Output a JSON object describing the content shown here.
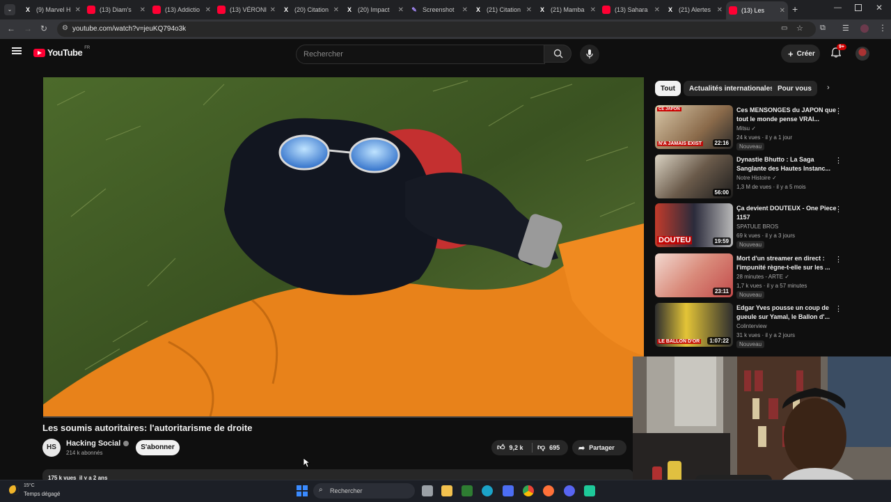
{
  "browser": {
    "tabs": [
      {
        "label": "(9) Marvel H",
        "icon": "x-icon"
      },
      {
        "label": "(13) Diam's",
        "icon": "youtube-icon"
      },
      {
        "label": "(13) Addictio",
        "icon": "youtube-icon"
      },
      {
        "label": "(13) VÉRONI",
        "icon": "youtube-icon"
      },
      {
        "label": "(20) Citation",
        "icon": "x-icon"
      },
      {
        "label": "(20) Impact",
        "icon": "x-icon"
      },
      {
        "label": "Screenshot",
        "icon": "pen-icon"
      },
      {
        "label": "(21) Citation",
        "icon": "x-icon"
      },
      {
        "label": "(21) Mamba",
        "icon": "x-icon"
      },
      {
        "label": "(13) Sahara",
        "icon": "youtube-icon"
      },
      {
        "label": "(21) Alertes",
        "icon": "x-icon"
      },
      {
        "label": "(13) Les",
        "icon": "youtube-icon",
        "active": true
      }
    ],
    "url": "youtube.com/watch?v=jeuKQ794o3k"
  },
  "header": {
    "logo": "YouTube",
    "region": "FR",
    "search_placeholder": "Rechercher",
    "create_label": "Créer",
    "notif_count": "9+"
  },
  "video": {
    "title": "Les soumis autoritaires: l'autoritarisme de droite",
    "channel": "Hacking Social",
    "channel_initials": "HS",
    "subscribers": "214 k abonnés",
    "subscribe_label": "S'abonner",
    "likes": "9,2 k",
    "dislikes": "695",
    "share_label": "Partager",
    "meta": "175 k vues  il y a 2 ans"
  },
  "chips": [
    "Tout",
    "Actualités internationales",
    "Pour vous"
  ],
  "recommendations": [
    {
      "title": "Ces MENSONGES du JAPON que tout le monde pense VRAI...",
      "channel": "Mitsu",
      "verified": true,
      "meta": "24 k vues · il y a 1 jour",
      "badge": "Nouveau",
      "duration": "22:16",
      "thumb_text": "N'A JAMAIS EXIST",
      "thumb_top": "CE JAPON"
    },
    {
      "title": "Dynastie Bhutto : La Saga Sanglante des Hautes Instanc...",
      "channel": "Notre Histoire",
      "verified": true,
      "meta": "1,3 M de vues · il y a 5 mois",
      "badge": "",
      "duration": "56:00",
      "thumb_text": "",
      "thumb_top": ""
    },
    {
      "title": "Ça devient DOUTEUX - One Piece 1157",
      "channel": "SPATULE BROS",
      "verified": false,
      "meta": "69 k vues · il y a 3 jours",
      "badge": "Nouveau",
      "duration": "19:59",
      "thumb_text": "DOUTEU",
      "thumb_top": ""
    },
    {
      "title": "Mort d'un streamer en direct : l'impunité règne-t-elle sur les ...",
      "channel": "28 minutes - ARTE",
      "verified": true,
      "meta": "1,7 k vues · il y a 57 minutes",
      "badge": "Nouveau",
      "duration": "23:11",
      "thumb_text": "",
      "thumb_top": ""
    },
    {
      "title": "Edgar Yves pousse un coup de gueule sur Yamal, le Ballon d'...",
      "channel": "Colinterview",
      "verified": false,
      "meta": "31 k vues · il y a 2 jours",
      "badge": "Nouveau",
      "duration": "1:07:22",
      "thumb_text": "LE BALLON D'OR",
      "thumb_top": ""
    }
  ],
  "taskbar": {
    "weather_temp": "15°C",
    "weather_desc": "Temps dégagé",
    "search_placeholder": "Rechercher"
  }
}
